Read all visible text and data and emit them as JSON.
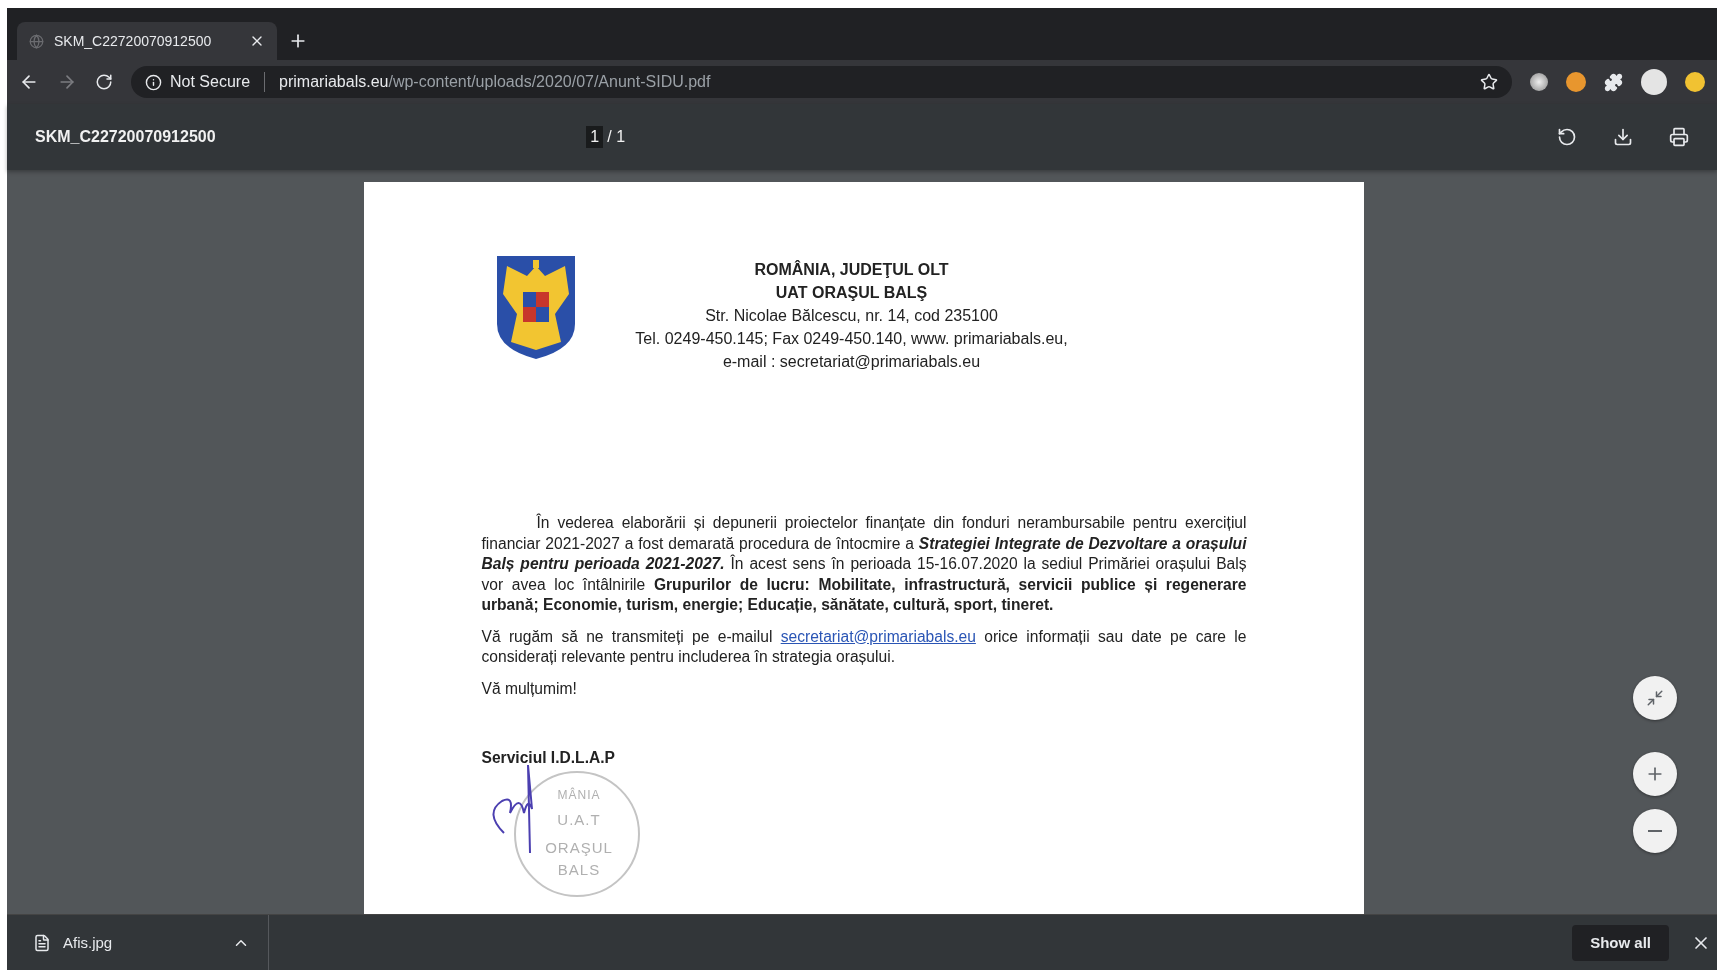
{
  "browser": {
    "tabs": [
      {
        "title": "SKM_C22720070912500",
        "selected": true
      }
    ],
    "toolbar": {
      "security": "Not Secure",
      "url_host": "primariabals.eu",
      "url_path": "/wp-content/uploads/2020/07/Anunt-SIDU.pdf",
      "forward_disabled": true
    }
  },
  "pdf_viewer": {
    "title": "SKM_C22720070912500",
    "page_current": "1",
    "page_total": "/ 1"
  },
  "document": {
    "letterhead": [
      {
        "text": "ROMÂNIA, JUDEŢUL OLT",
        "bold": true
      },
      {
        "text": "UAT ORAŞUL BALŞ",
        "bold": true
      },
      {
        "text": "Str. Nicolae Bălcescu, nr. 14, cod 235100",
        "bold": false
      },
      {
        "text": "Tel. 0249-450.145; Fax 0249-450.140, www. primariabals.eu,",
        "bold": false
      },
      {
        "text": "e-mail : secretariat@primariabals.eu",
        "bold": false
      }
    ],
    "paragraphs": [
      {
        "indented": true,
        "segments": [
          {
            "kind": "plain",
            "text": "În vederea elaborării și depunerii proiectelor finanțate din fonduri nerambursabile pentru exercițiul financiar 2021-2027 a fost demarată procedura de întocmire a "
          },
          {
            "kind": "bold_italic",
            "text": "Strategiei Integrate de Dezvoltare a orașului Balș pentru perioada 2021-2027."
          },
          {
            "kind": "plain",
            "text": " În acest sens în perioada 15-16.07.2020 la sediul Primăriei orașului Balș vor avea loc întâlnirile "
          },
          {
            "kind": "bold",
            "text": "Grupurilor de lucru: Mobilitate, infrastructură, servicii publice și regenerare urbană; Economie, turism, energie; Educație, sănătate, cultură, sport, tineret."
          }
        ]
      },
      {
        "indented": false,
        "segments": [
          {
            "kind": "plain",
            "text": "Vă rugăm să ne transmiteți pe e-mailul "
          },
          {
            "kind": "link",
            "text": "secretariat@primariabals.eu"
          },
          {
            "kind": "plain",
            "text": " orice informații sau date pe care le considerați relevante pentru includerea în strategia orașului."
          }
        ]
      },
      {
        "indented": false,
        "segments": [
          {
            "kind": "plain",
            "text": "Vă mulțumim!"
          }
        ]
      }
    ],
    "signature": "Serviciul I.D.L.A.P",
    "stamp": [
      "MÂNIA",
      "U.A.T",
      "ORAŞUL",
      "BALS"
    ]
  },
  "download_bar": {
    "items": [
      {
        "name": "Afis.jpg"
      }
    ],
    "show_all": "Show all"
  }
}
